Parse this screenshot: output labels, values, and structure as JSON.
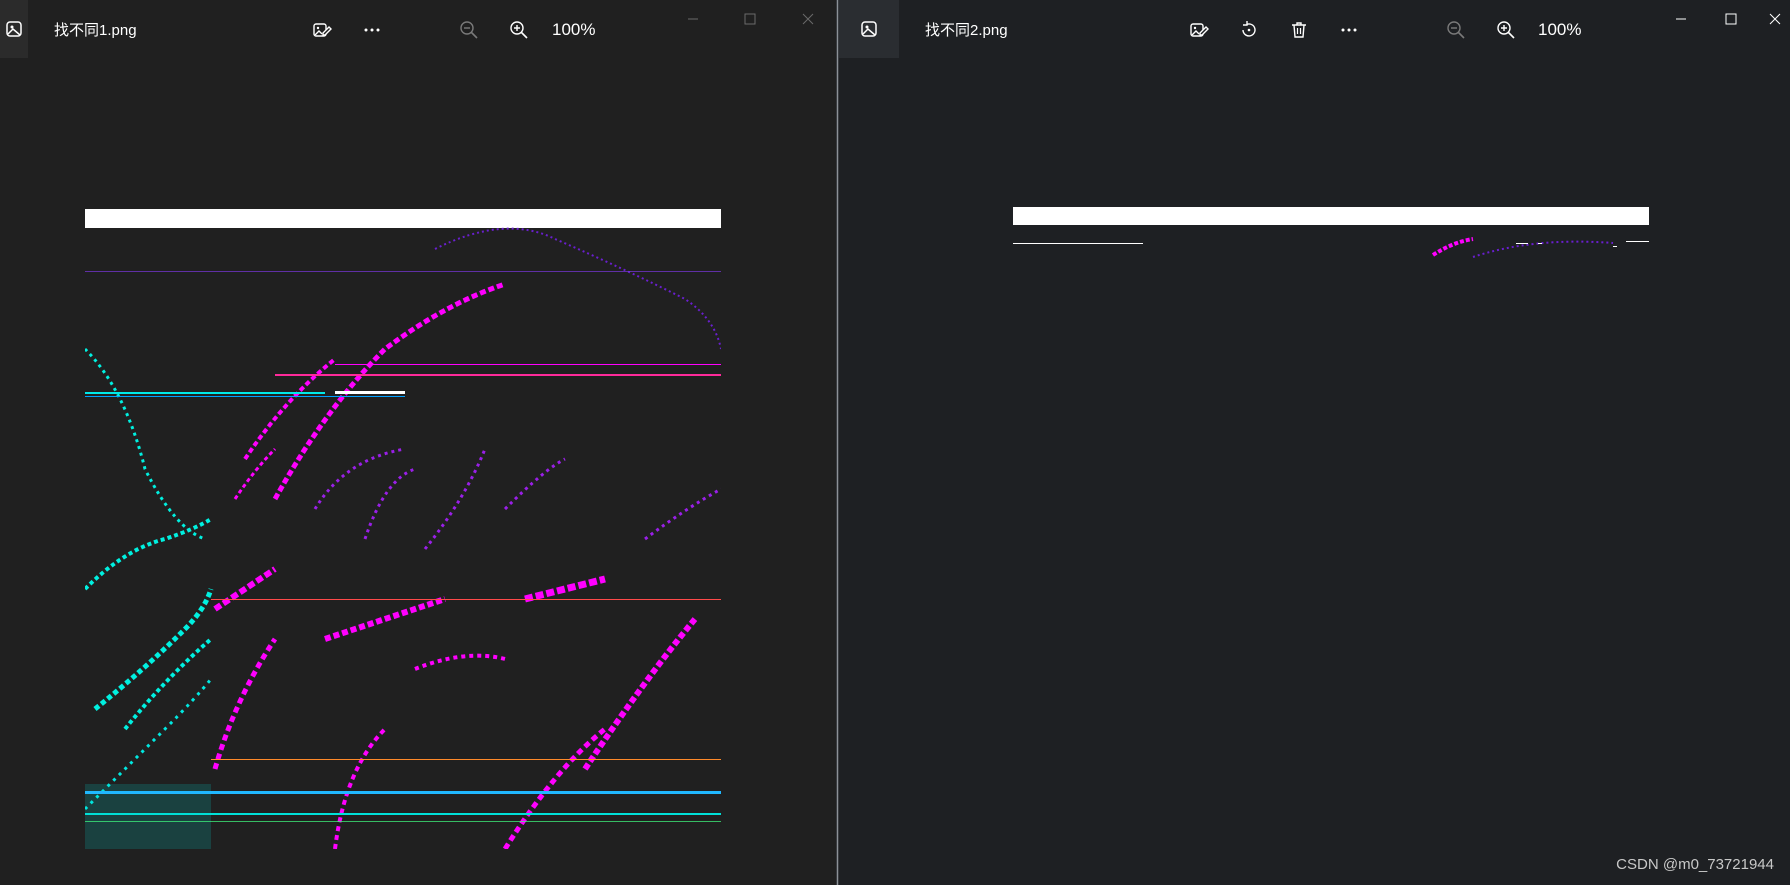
{
  "left_window": {
    "title": "找不同1.png",
    "zoom": "100%",
    "toolbar": [
      "edit-image-icon",
      "more-options-icon",
      "zoom-out-icon",
      "zoom-in-icon"
    ],
    "caption_buttons": [
      "minimize-icon",
      "maximize-icon",
      "close-icon"
    ]
  },
  "right_window": {
    "title": "找不同2.png",
    "zoom": "100%",
    "toolbar": [
      "edit-image-icon",
      "rotate-icon",
      "delete-icon",
      "more-options-icon",
      "zoom-out-icon",
      "zoom-in-icon"
    ],
    "caption_buttons": [
      "minimize-icon",
      "maximize-icon",
      "close-icon"
    ]
  },
  "watermark": "CSDN @m0_73721944",
  "colors": {
    "magenta": "#ff00ff",
    "cyan": "#00ffee",
    "purple": "#7a1fd6",
    "white_bar": "#ffffff"
  }
}
